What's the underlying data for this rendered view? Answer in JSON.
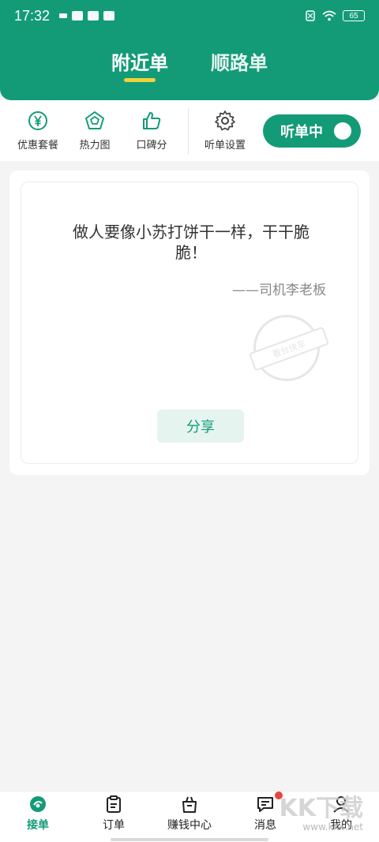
{
  "status_bar": {
    "time": "17:32",
    "battery": "65",
    "icons": [
      "sim-icon",
      "mail-icon",
      "leaf-icon",
      "baidu-icon",
      "no-sim-icon",
      "wifi-icon"
    ]
  },
  "header": {
    "tabs": [
      {
        "label": "附近单",
        "active": true
      },
      {
        "label": "顺路单",
        "active": false
      }
    ],
    "accent_color": "#139b78",
    "underline_color": "#f0d238"
  },
  "toolbar": {
    "items": [
      {
        "label": "优惠套餐",
        "icon": "yen-icon"
      },
      {
        "label": "热力图",
        "icon": "pentagon-icon"
      },
      {
        "label": "口碑分",
        "icon": "thumbs-up-icon"
      },
      {
        "label": "听单设置",
        "icon": "gear-icon"
      }
    ],
    "listen_label": "听单中"
  },
  "card": {
    "quote": "做人要像小苏打饼干一样，干干脆脆！",
    "author": "——司机李老板",
    "stamp_text": "看台快车",
    "share_label": "分享"
  },
  "bottom_nav": {
    "items": [
      {
        "label": "接单",
        "icon": "order-accept-icon",
        "active": true
      },
      {
        "label": "订单",
        "icon": "clipboard-icon"
      },
      {
        "label": "赚钱中心",
        "icon": "bag-icon"
      },
      {
        "label": "消息",
        "icon": "message-icon",
        "badge": true
      },
      {
        "label": "我的",
        "icon": "user-icon"
      }
    ]
  },
  "watermark": {
    "text": "KK下载",
    "url": "www.kkx.net"
  }
}
